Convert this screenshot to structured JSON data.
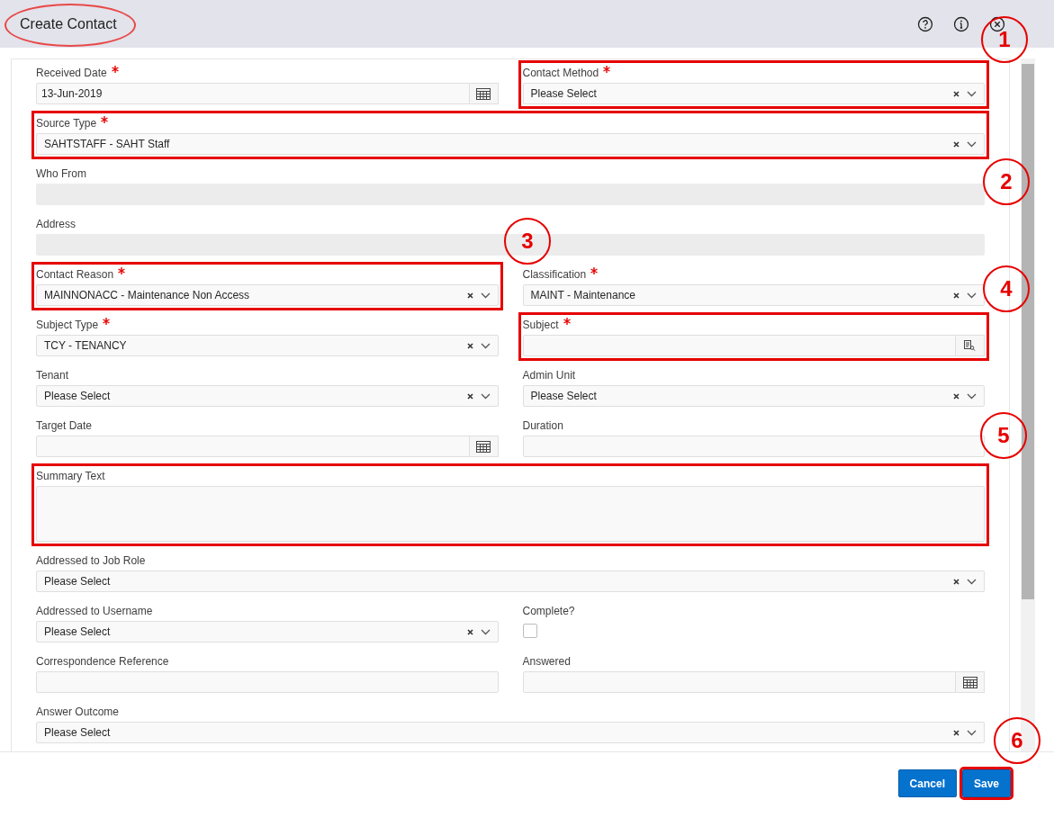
{
  "window": {
    "title": "Create Contact",
    "title_circled": true
  },
  "rows": [
    [
      {
        "label": "Received Date",
        "required": true,
        "kind": "date",
        "value": "13-Jun-2019",
        "highlighted": false
      },
      {
        "label": "Contact Method",
        "required": true,
        "kind": "select",
        "value": "Please Select",
        "highlighted": true
      }
    ],
    [
      {
        "label": "Source Type",
        "required": true,
        "kind": "select",
        "value": "SAHTSTAFF - SAHT Staff",
        "highlighted": true
      }
    ],
    [
      {
        "label": "Who From",
        "required": false,
        "kind": "readonly",
        "highlighted": false
      }
    ],
    [
      {
        "label": "Address",
        "required": false,
        "kind": "readonly",
        "highlighted": false
      }
    ],
    [
      {
        "label": "Contact Reason",
        "required": true,
        "kind": "select",
        "value": "MAINNONACC - Maintenance Non Access",
        "highlighted": true
      },
      {
        "label": "Classification",
        "required": true,
        "kind": "select",
        "value": "MAINT - Maintenance",
        "highlighted": false
      }
    ],
    [
      {
        "label": "Subject Type",
        "required": true,
        "kind": "select",
        "value": "TCY - TENANCY",
        "highlighted": false
      },
      {
        "label": "Subject",
        "required": true,
        "kind": "lookup",
        "highlighted": true
      }
    ],
    [
      {
        "label": "Tenant",
        "required": false,
        "kind": "select",
        "value": "Please Select",
        "highlighted": false
      },
      {
        "label": "Admin Unit",
        "required": false,
        "kind": "select",
        "value": "Please Select",
        "highlighted": false
      }
    ],
    [
      {
        "label": "Target Date",
        "required": false,
        "kind": "date",
        "highlighted": false
      },
      {
        "label": "Duration",
        "required": false,
        "kind": "text",
        "highlighted": false
      }
    ],
    [
      {
        "label": "Summary Text",
        "required": false,
        "kind": "textarea",
        "highlighted": true
      }
    ],
    [
      {
        "label": "Addressed to Job Role",
        "required": false,
        "kind": "select",
        "value": "Please Select",
        "highlighted": false
      }
    ],
    [
      {
        "label": "Addressed to Username",
        "required": false,
        "kind": "select",
        "value": "Please Select",
        "highlighted": false
      },
      {
        "label": "Complete?",
        "required": false,
        "kind": "checkbox",
        "checked": false,
        "highlighted": false
      }
    ],
    [
      {
        "label": "Correspondence Reference",
        "required": false,
        "kind": "text",
        "highlighted": false
      },
      {
        "label": "Answered",
        "required": false,
        "kind": "date",
        "highlighted": false
      }
    ],
    [
      {
        "label": "Answer Outcome",
        "required": false,
        "kind": "select",
        "value": "Please Select",
        "highlighted": false
      }
    ]
  ],
  "buttons": [
    {
      "label": "Cancel",
      "highlighted": false
    },
    {
      "label": "Save",
      "highlighted": true
    }
  ],
  "callouts": [
    "1",
    "2",
    "3",
    "4",
    "5",
    "6"
  ]
}
